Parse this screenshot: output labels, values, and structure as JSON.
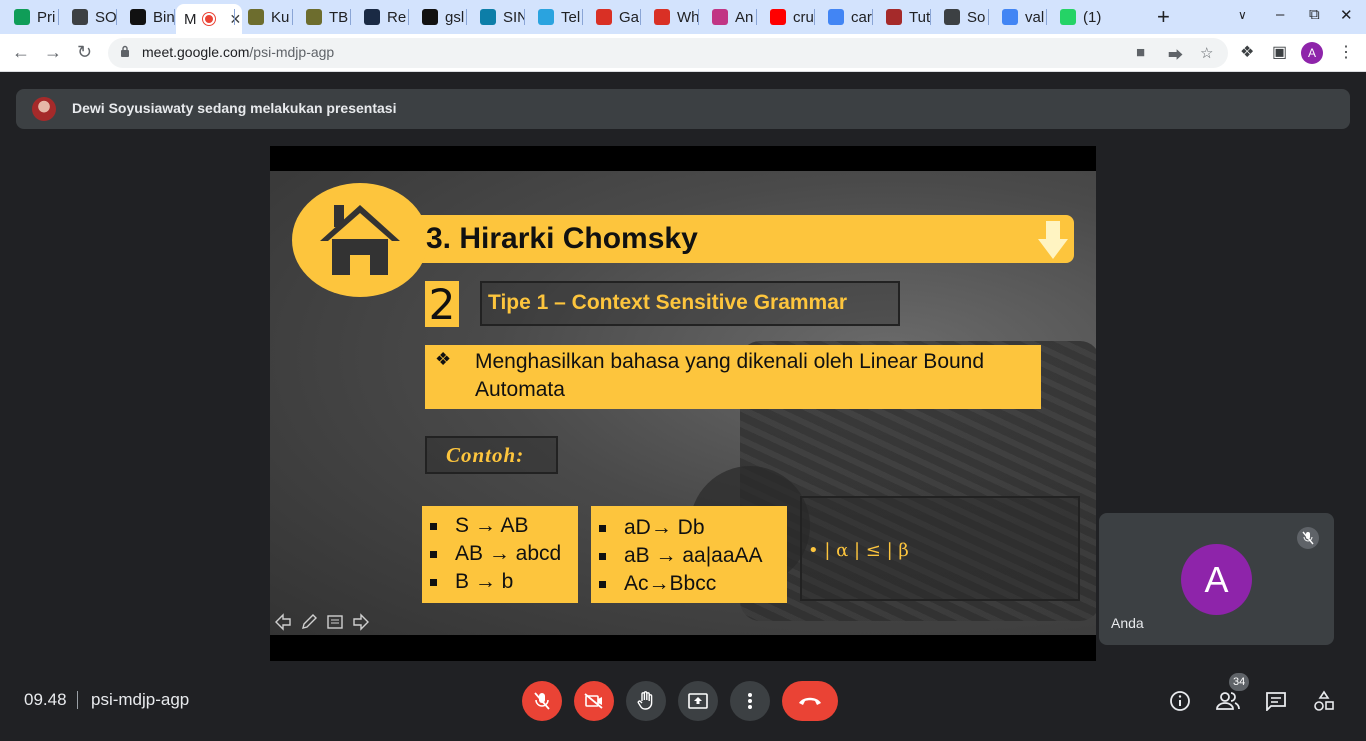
{
  "browser": {
    "tabs": [
      {
        "label": "Pri",
        "icon": "wavy-icon",
        "color": "#0f9d58"
      },
      {
        "label": "SO",
        "icon": "globe-icon",
        "color": "#3c4043"
      },
      {
        "label": "Bin",
        "icon": "va-icon",
        "color": "#111111"
      },
      {
        "label": "M",
        "icon": "recording-icon",
        "color": "#ea4335",
        "active": true
      },
      {
        "label": "Ku",
        "icon": "seal-icon",
        "color": "#6d6d2e"
      },
      {
        "label": "TB",
        "icon": "seal-icon",
        "color": "#6d6d2e"
      },
      {
        "label": "Re",
        "icon": "spark-icon",
        "color": "#1a2a44"
      },
      {
        "label": "gsl",
        "icon": "github-icon",
        "color": "#111111"
      },
      {
        "label": "SIN",
        "icon": "swirl-icon",
        "color": "#0d7ea8"
      },
      {
        "label": "Tel",
        "icon": "telegram-icon",
        "color": "#2aa3df"
      },
      {
        "label": "Ga",
        "icon": "arc-icon",
        "color": "#d93025"
      },
      {
        "label": "Wh",
        "icon": "alert-icon",
        "color": "#d93025"
      },
      {
        "label": "An",
        "icon": "instagram-icon",
        "color": "#c13584"
      },
      {
        "label": "cru",
        "icon": "youtube-icon",
        "color": "#ff0000"
      },
      {
        "label": "car",
        "icon": "google-icon",
        "color": "#4285f4"
      },
      {
        "label": "Tut",
        "icon": "t-icon",
        "color": "#a52a2a"
      },
      {
        "label": "So",
        "icon": "diag-icon",
        "color": "#3c4043"
      },
      {
        "label": "val",
        "icon": "google-icon",
        "color": "#4285f4"
      },
      {
        "label": "(1)",
        "icon": "one-icon",
        "color": "#25d366"
      }
    ],
    "url_host": "meet.google.com",
    "url_path": "/psi-mdjp-agp",
    "profile_initial": "A"
  },
  "meet": {
    "banner_text": "Dewi Soyusiawaty sedang melakukan presentasi",
    "self_name": "Anda",
    "self_initial": "A",
    "time": "09.48",
    "meeting_code": "psi-mdjp-agp",
    "participants_count": "34"
  },
  "slide": {
    "title": "3. Hirarki Chomsky",
    "number": "2",
    "subtitle": "Tipe 1 – Context Sensitive Grammar",
    "bullet_mark": "❖",
    "bullet_text": "Menghasilkan bahasa yang dikenali oleh Linear Bound Automata",
    "example_label": "Contoh:",
    "rules_left": [
      "S → AB",
      "AB → abcd",
      "B → b"
    ],
    "rules_middle": [
      "aD→ Db",
      "aB →  aa|aaAA",
      "Ac→Bbcc"
    ],
    "condition": "•    | α | ≤ | β"
  },
  "colors": {
    "slide_yellow": "#fdc53d",
    "end_call_red": "#ea4335",
    "avatar_purple": "#8e24aa"
  }
}
